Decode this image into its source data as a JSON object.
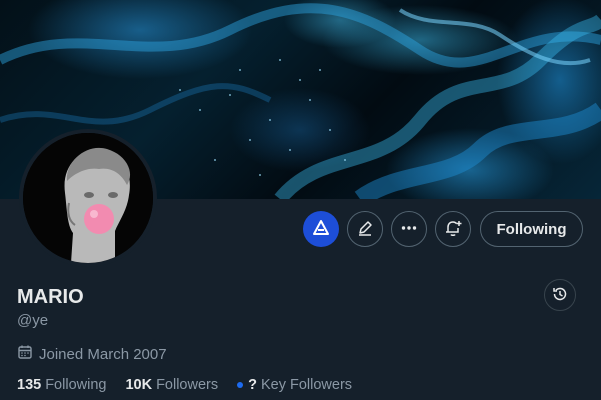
{
  "profile": {
    "name": "MARIO",
    "handle": "@ye",
    "joined": "Joined March 2007"
  },
  "actions": {
    "following_label": "Following"
  },
  "stats": {
    "following_count": "135",
    "following_label": "Following",
    "followers_count": "10K",
    "followers_label": "Followers",
    "key_followers_count": "?",
    "key_followers_label": "Key Followers"
  },
  "icons": {
    "grok": "grok-icon",
    "edit": "pencil-icon",
    "more": "more-icon",
    "notify": "bell-plus-icon",
    "history": "history-icon",
    "calendar": "calendar-icon"
  },
  "colors": {
    "background": "#15202b",
    "grok_accent": "#1d4ed8",
    "secondary_text": "#8b98a5",
    "bubble_gum": "#f28bb0"
  }
}
